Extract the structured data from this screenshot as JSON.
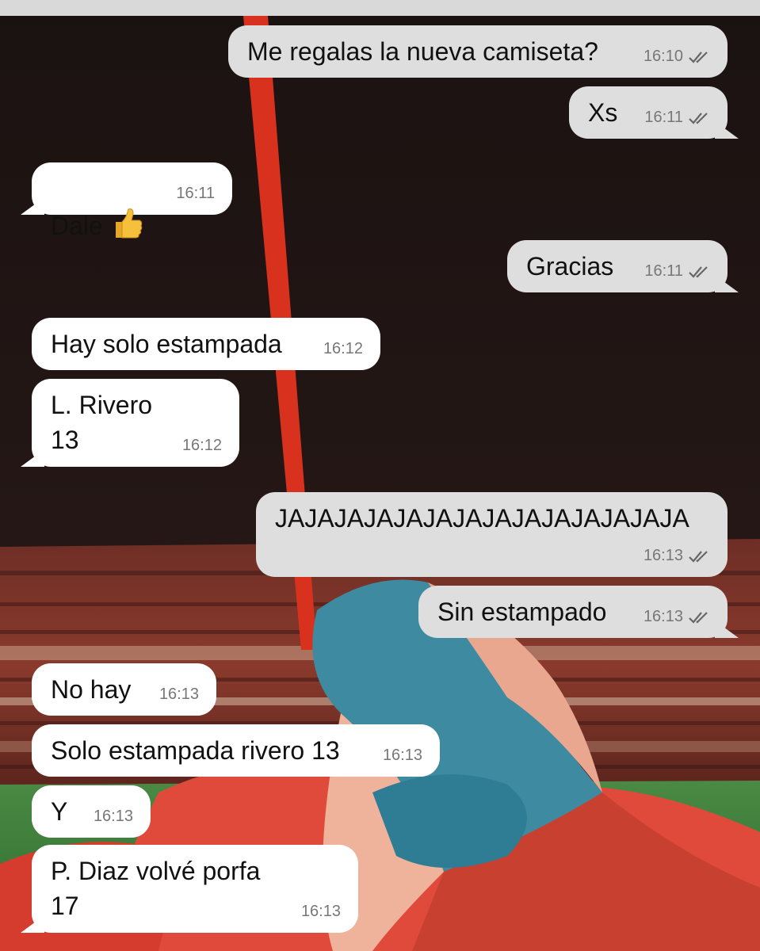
{
  "messages": [
    {
      "id": "m1",
      "dir": "sent",
      "text": "Me regalas la nueva camiseta?",
      "time": "16:10",
      "status": "read"
    },
    {
      "id": "m2",
      "dir": "sent",
      "text": "Xs",
      "time": "16:11",
      "status": "read"
    },
    {
      "id": "m3",
      "dir": "recv",
      "text": "Dale",
      "emoji": "thumbs-up",
      "time": "16:11"
    },
    {
      "id": "m4",
      "dir": "sent",
      "text": "Gracias",
      "time": "16:11",
      "status": "read"
    },
    {
      "id": "m5",
      "dir": "recv",
      "text": "Hay solo estampada",
      "time": "16:12"
    },
    {
      "id": "m6",
      "dir": "recv",
      "text": "L. Rivero\n13",
      "time": "16:12"
    },
    {
      "id": "m7",
      "dir": "sent",
      "text": "JAJAJAJAJAJAJAJAJAJAJAJAJAJA",
      "time": "16:13",
      "status": "read"
    },
    {
      "id": "m8",
      "dir": "sent",
      "text": "Sin estampado",
      "time": "16:13",
      "status": "read"
    },
    {
      "id": "m9",
      "dir": "recv",
      "text": "No hay",
      "time": "16:13"
    },
    {
      "id": "m10",
      "dir": "recv",
      "text": "Solo estampada rivero 13",
      "time": "16:13"
    },
    {
      "id": "m11",
      "dir": "recv",
      "text": "Y",
      "time": "16:13"
    },
    {
      "id": "m12",
      "dir": "recv",
      "text": "P. Diaz volvé porfa\n17",
      "time": "16:13"
    }
  ],
  "icons": {
    "read_receipt": "double-check-icon",
    "emoji": "thumbs-up-icon"
  },
  "colors": {
    "sent_bubble": "#dedede",
    "recv_bubble": "#ffffff",
    "sky": "#1c1413",
    "pole": "#d8321f",
    "grass": "#3c7c3a"
  }
}
